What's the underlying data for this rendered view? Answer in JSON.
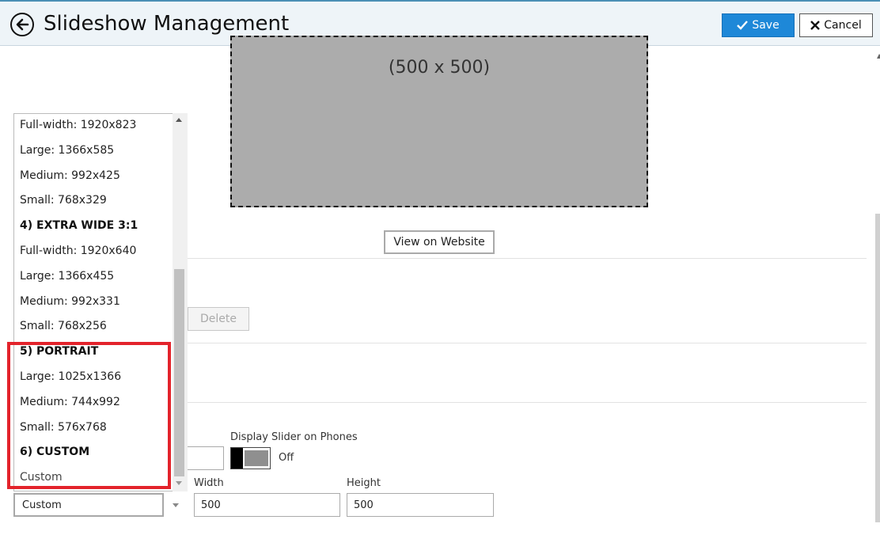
{
  "header": {
    "title": "Slideshow Management",
    "save_label": "Save",
    "cancel_label": "Cancel",
    "accent_color": "#1e88d8"
  },
  "preview": {
    "size_label": "(500 x 500)",
    "view_button": "View on Website"
  },
  "actions": {
    "delete_label": "Delete"
  },
  "settings": {
    "display_phones_label": "Display Slider on Phones",
    "display_phones_state": "Off",
    "width_label": "Width",
    "width_value": "500",
    "height_label": "Height",
    "height_value": "500",
    "size_select_value": "Custom"
  },
  "dropdown": {
    "items": [
      {
        "label": "Full-width: 1920x823",
        "group": false
      },
      {
        "label": "Large: 1366x585",
        "group": false
      },
      {
        "label": "Medium: 992x425",
        "group": false
      },
      {
        "label": "Small: 768x329",
        "group": false
      },
      {
        "label": "4) EXTRA WIDE 3:1",
        "group": true
      },
      {
        "label": "Full-width: 1920x640",
        "group": false
      },
      {
        "label": "Large: 1366x455",
        "group": false
      },
      {
        "label": "Medium: 992x331",
        "group": false
      },
      {
        "label": "Small: 768x256",
        "group": false
      },
      {
        "label": "5) PORTRAIT",
        "group": true
      },
      {
        "label": "Large: 1025x1366",
        "group": false
      },
      {
        "label": "Medium: 744x992",
        "group": false
      },
      {
        "label": "Small: 576x768",
        "group": false
      },
      {
        "label": "6) CUSTOM",
        "group": true
      },
      {
        "label": "Custom",
        "group": false
      }
    ],
    "highlight_color": "#e3232b"
  }
}
